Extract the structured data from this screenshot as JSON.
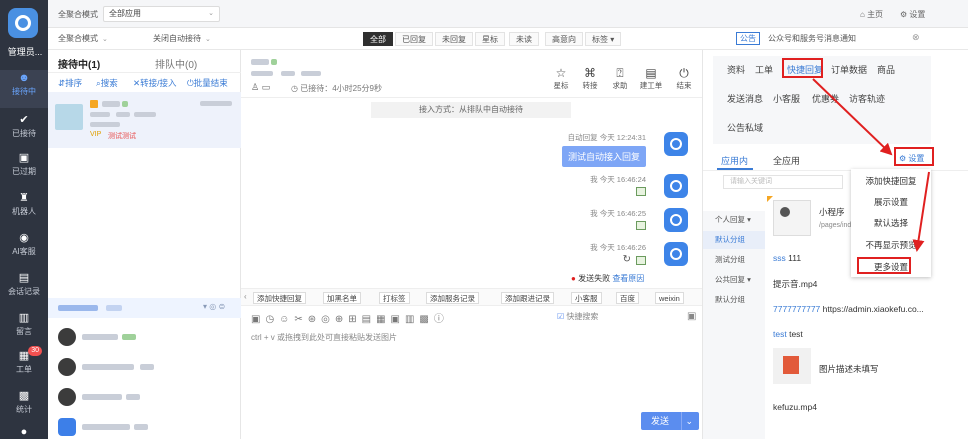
{
  "nav": {
    "brand": "管理员...",
    "items": [
      {
        "label": "接待中",
        "icon": "chat-icon",
        "active": true
      },
      {
        "label": "已接待",
        "icon": "check-icon"
      },
      {
        "label": "已过期",
        "icon": "clock-icon"
      },
      {
        "label": "机器人",
        "icon": "robot-icon"
      },
      {
        "label": "AI客服",
        "icon": "ai-icon"
      },
      {
        "label": "会话记录",
        "icon": "record-icon"
      },
      {
        "label": "留言",
        "icon": "message-icon"
      },
      {
        "label": "工单",
        "icon": "ticket-icon",
        "badge": "30"
      },
      {
        "label": "统计",
        "icon": "stats-icon"
      }
    ]
  },
  "topbar": {
    "mode_label": "全聚合模式",
    "app_select": "全部应用",
    "home": "主页",
    "settings": "设置"
  },
  "toolbar2": {
    "mode": "全聚合模式",
    "auto_reception": "关闭自动接待",
    "filters": [
      "全部",
      "已回复",
      "未回复",
      "星标",
      "未读",
      "高意向",
      "标签"
    ],
    "notice_tag": "公告",
    "notice_text": "公众号和服务号消息通知"
  },
  "list": {
    "tab_active": "接待中(1)",
    "tab_queue": "排队中(0)",
    "actions": [
      "排序",
      "搜索",
      "转接/接入",
      "批量结束"
    ],
    "conv": {
      "vip": "VIP",
      "tag": "测试测试"
    }
  },
  "chat": {
    "status": "已接待：4小时25分9秒",
    "head_icons": [
      "星标",
      "转接",
      "求助",
      "建工单",
      "结束"
    ],
    "system_msg": "接入方式：从排队中自动接待",
    "messages": [
      {
        "meta": "自动回复 今天 12:24:31",
        "text": "测试自动接入回复"
      },
      {
        "meta": "我 今天 16:46:24"
      },
      {
        "meta": "我 今天 16:46:25"
      },
      {
        "meta": "我 今天 16:46:26"
      }
    ],
    "send_failed": "发送失败",
    "view_reason": "查看原因",
    "tools": [
      "添加快捷回复",
      "加黑名单",
      "打标签",
      "添加服务记录",
      "添加跟进记录",
      "小客服",
      "百度",
      "weixin"
    ],
    "quick_search": "快捷搜索",
    "hint": "ctrl + v 或拖拽到此处可直接粘贴发送图片",
    "send": "发送"
  },
  "right": {
    "tabs1": [
      "资料",
      "工单",
      "快捷回复",
      "订单数据",
      "商品"
    ],
    "tabs2": [
      "发送消息",
      "小客服",
      "优惠券",
      "访客轨迹"
    ],
    "tabs3": [
      "公告私域"
    ],
    "sub_tabs": [
      "应用内",
      "全应用"
    ],
    "settings_btn": "设置",
    "search_placeholder": "请输入关键词",
    "menu": [
      "添加快捷回复",
      "展示设置",
      "默认选择",
      "不再显示预览",
      "更多设置"
    ],
    "categories": [
      "个人回复",
      "默认分组",
      "测试分组",
      "公共回复",
      "默认分组"
    ],
    "mini_program_title": "小程序",
    "mini_program_path": "/pages/ind",
    "items": [
      {
        "key": "sss",
        "text": "111"
      },
      {
        "text": "提示音.mp4"
      },
      {
        "key": "7777777777",
        "text": "https://admin.xiaokefu.co..."
      },
      {
        "key": "test",
        "text": "test"
      },
      {
        "text": "图片描述未填写"
      },
      {
        "text": "kefuzu.mp4"
      }
    ]
  }
}
